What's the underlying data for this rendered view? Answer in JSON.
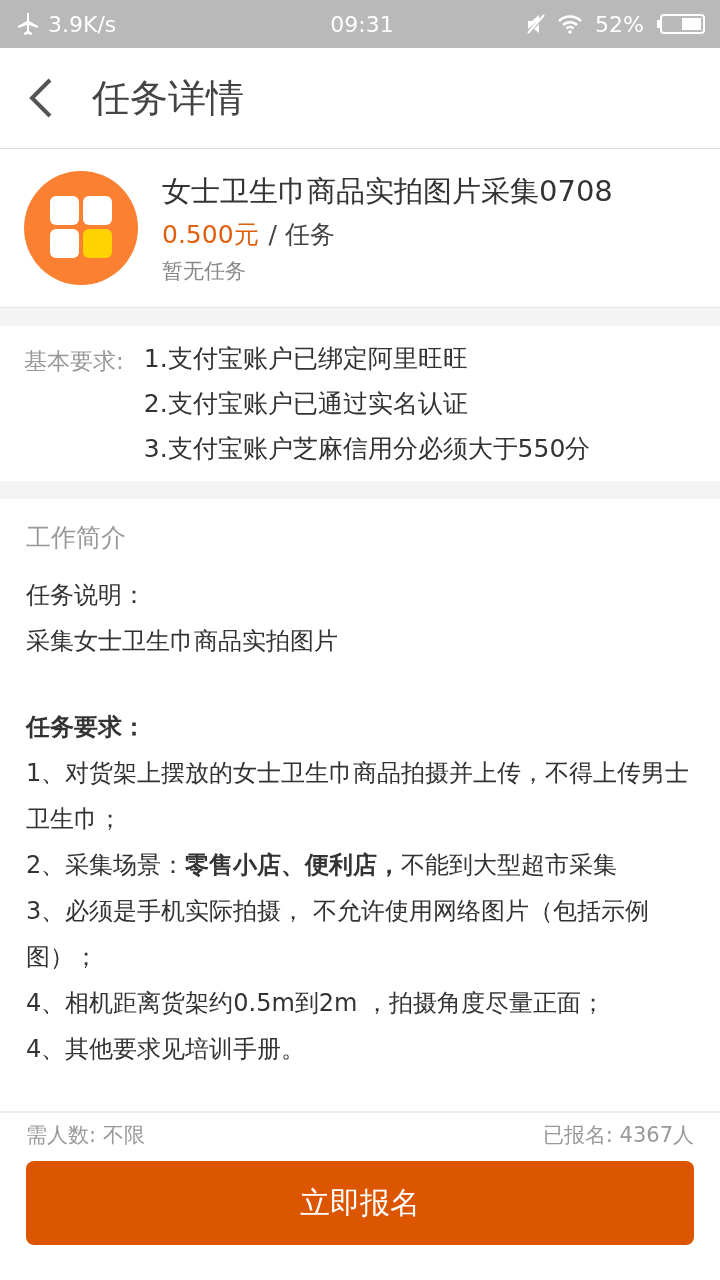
{
  "status_bar": {
    "speed": "3.9K/s",
    "time": "09:31",
    "battery": "52%"
  },
  "header": {
    "title": "任务详情"
  },
  "task": {
    "name": "女士卫生巾商品实拍图片采集0708",
    "price": "0.500元",
    "unit": "/ 任务",
    "status": "暂无任务"
  },
  "requirements": {
    "label": "基本要求:",
    "items": [
      "1.支付宝账户已绑定阿里旺旺",
      "2.支付宝账户已通过实名认证",
      "3.支付宝账户芝麻信用分必须大于550分"
    ]
  },
  "intro": {
    "title": "工作简介",
    "lines": [
      {
        "kind": "text",
        "text": "任务说明："
      },
      {
        "kind": "text",
        "text": "采集女士卫生巾商品实拍图片"
      },
      {
        "kind": "heading",
        "text": "任务要求："
      },
      {
        "kind": "text",
        "text": "1、对货架上摆放的女士卫生巾商品拍摄并上传，不得上传男士卫生巾；"
      },
      {
        "kind": "text",
        "text": "2、采集场景：**零售小店、便利店，**不能到大型超市采集"
      },
      {
        "kind": "text",
        "text": "3、必须是手机实际拍摄， 不允许使用网络图片（包括示例图）；"
      },
      {
        "kind": "text",
        "text": "4、相机距离货架约0.5m到2m ，拍摄角度尽量正面；"
      },
      {
        "kind": "text",
        "text": "4、其他要求见培训手册。"
      }
    ]
  },
  "footer": {
    "needed": "需人数: 不限",
    "enrolled": "已报名: 4367人",
    "button": "立即报名"
  }
}
